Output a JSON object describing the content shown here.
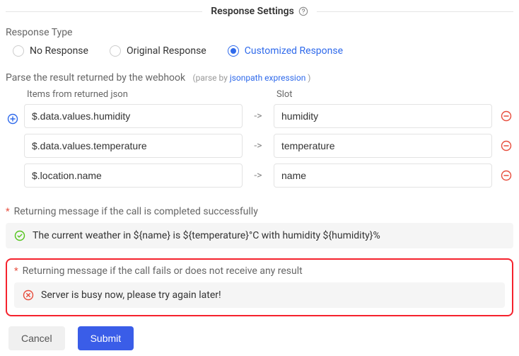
{
  "header": {
    "title": "Response Settings"
  },
  "responseType": {
    "label": "Response Type",
    "options": [
      {
        "label": "No Response",
        "selected": false
      },
      {
        "label": "Original Response",
        "selected": false
      },
      {
        "label": "Customized Response",
        "selected": true
      }
    ]
  },
  "parse": {
    "label": "Parse the result returned by the webhook",
    "hint_prefix": "(parse by ",
    "hint_link": "jsonpath expression",
    "hint_suffix": " )",
    "col_json": "Items from returned json",
    "col_slot": "Slot",
    "arrow": "->",
    "rows": [
      {
        "json": "$.data.values.humidity",
        "slot": "humidity"
      },
      {
        "json": "$.data.values.temperature",
        "slot": "temperature"
      },
      {
        "json": "$.location.name",
        "slot": "name"
      }
    ]
  },
  "successMsg": {
    "label": "Returning message if the call is completed successfully",
    "value": "The current weather in ${name} is ${temperature}°C with humidity ${humidity}%"
  },
  "failMsg": {
    "label": "Returning message if the call fails or does not receive any result",
    "value": "Server is busy now, please try again later!"
  },
  "actions": {
    "cancel": "Cancel",
    "submit": "Submit"
  }
}
